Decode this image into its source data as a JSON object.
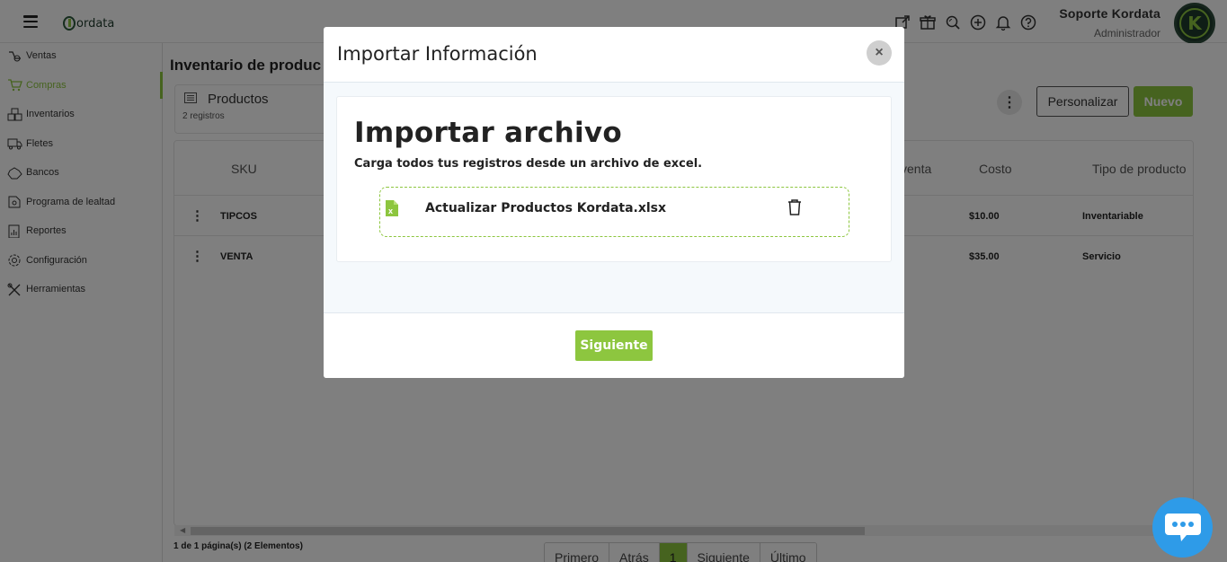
{
  "app": {
    "logo_text": "ordata",
    "user_name": "Soporte Kordata",
    "user_role": "Administrador",
    "avatar_letter": "K",
    "brand_color": "#8dc63f",
    "top_icons": [
      "external-link-icon",
      "gift-icon",
      "search-icon",
      "plus-circle-icon",
      "bell-icon",
      "help-icon"
    ]
  },
  "sidebar": {
    "items": [
      {
        "label": "Ventas",
        "icon": "sales-icon",
        "active": false
      },
      {
        "label": "Compras",
        "icon": "cart-icon",
        "active": true
      },
      {
        "label": "Inventarios",
        "icon": "boxes-icon",
        "active": false
      },
      {
        "label": "Fletes",
        "icon": "truck-icon",
        "active": false
      },
      {
        "label": "Bancos",
        "icon": "bank-icon",
        "active": false
      },
      {
        "label": "Programa de lealtad",
        "icon": "loyalty-icon",
        "active": false
      },
      {
        "label": "Reportes",
        "icon": "report-icon",
        "active": false
      },
      {
        "label": "Configuración",
        "icon": "gear-icon",
        "active": false
      },
      {
        "label": "Herramientas",
        "icon": "tools-icon",
        "active": false
      }
    ]
  },
  "main": {
    "title": "Inventario de produc",
    "list": {
      "title": "Productos",
      "count": "2 registros"
    },
    "buttons": {
      "customize": "Personalizar",
      "new": "Nuevo",
      "more": "⋮"
    },
    "table": {
      "headers": {
        "sku": "SKU",
        "venta": "venta",
        "costo": "Costo",
        "tipo": "Tipo de producto"
      },
      "rows": [
        {
          "sku": "TIPCOS",
          "costo": "$10.00",
          "tipo": "Inventariable"
        },
        {
          "sku": "VENTA",
          "costo": "$35.00",
          "tipo": "Servicio"
        }
      ]
    },
    "pagination": {
      "info": "1 de 1 página(s) (2 Elementos)",
      "first": "Primero",
      "prev": "Atrás",
      "current": "1",
      "next": "Siguiente",
      "last": "Último"
    }
  },
  "modal": {
    "title": "Importar Información",
    "close": "×",
    "heading": "Importar archivo",
    "subtitle": "Carga todos tus registros desde un archivo de excel.",
    "file_name": "Actualizar Productos Kordata.xlsx",
    "next_button": "Siguiente"
  }
}
